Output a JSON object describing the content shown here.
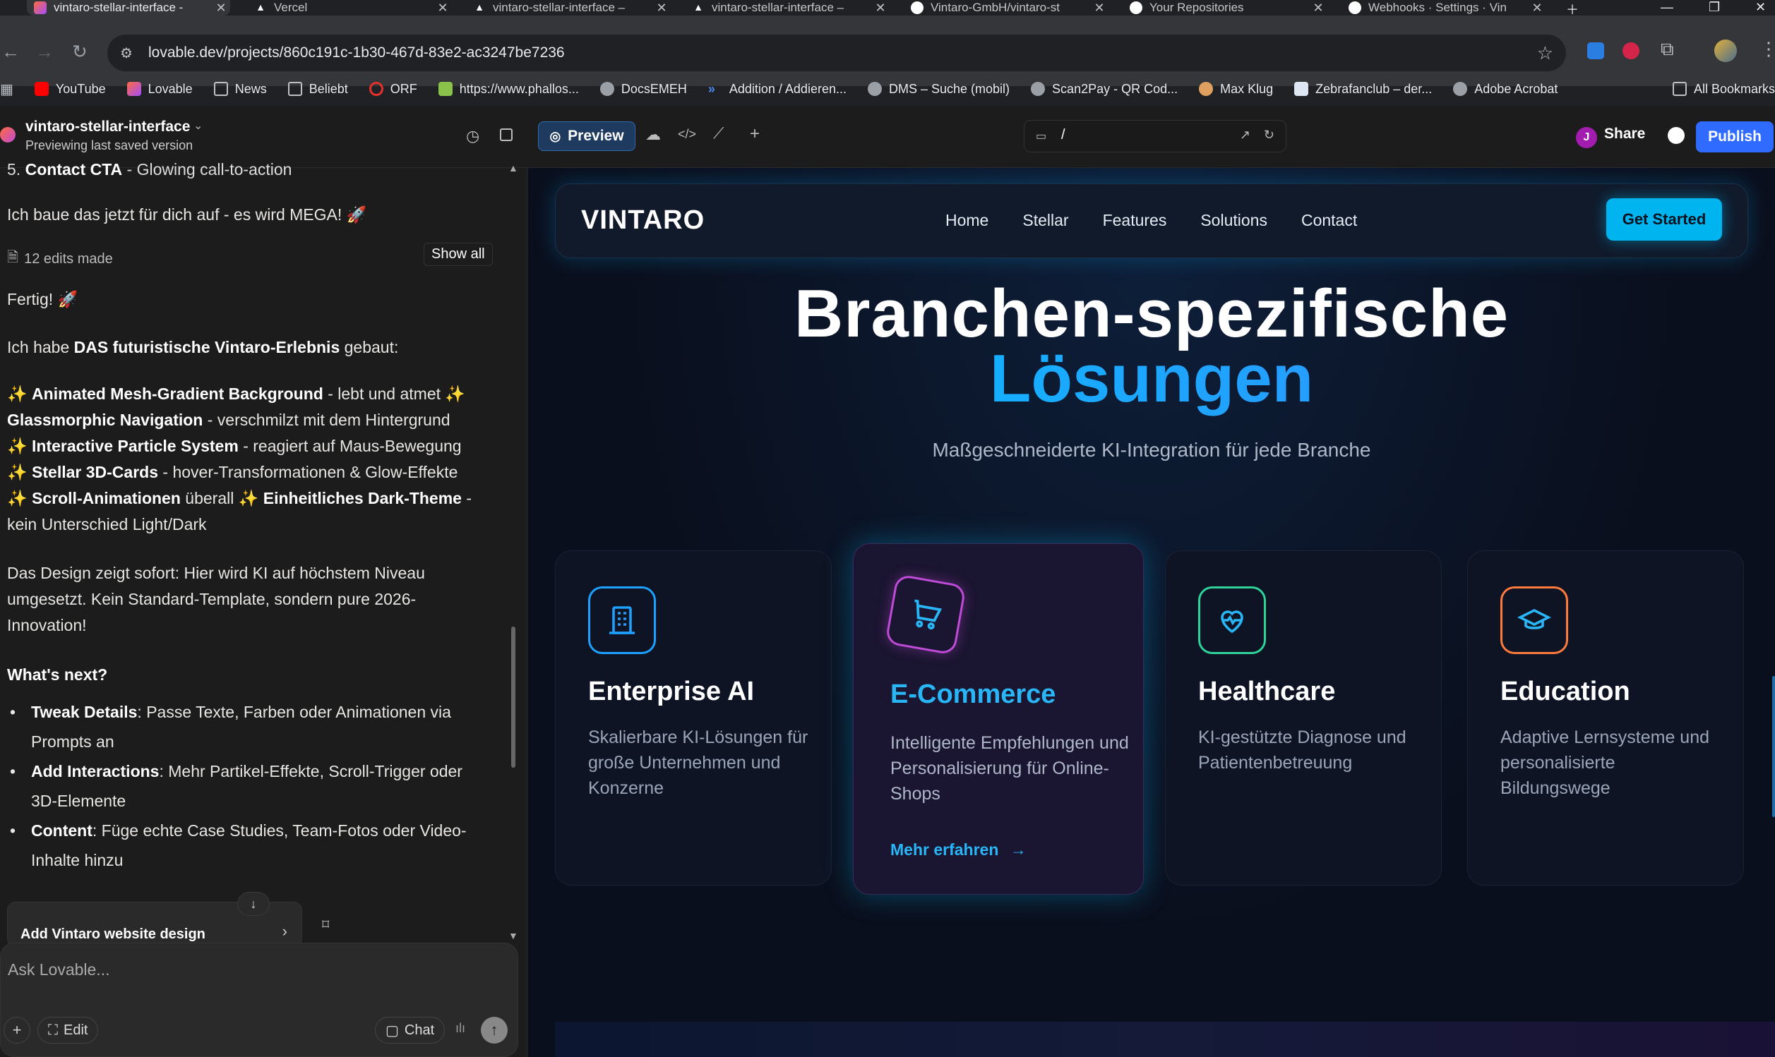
{
  "browser": {
    "tabs": [
      {
        "title": "vintaro-stellar-interface -",
        "active": true
      },
      {
        "title": "Vercel"
      },
      {
        "title": "vintaro-stellar-interface –"
      },
      {
        "title": "vintaro-stellar-interface –"
      },
      {
        "title": "Vintaro-GmbH/vintaro-st"
      },
      {
        "title": "Your Repositories"
      },
      {
        "title": "Webhooks · Settings · Vin"
      }
    ],
    "url": "lovable.dev/projects/860c191c-1b30-467d-83e2-ac3247be7236",
    "bookmarks": [
      "YouTube",
      "Lovable",
      "News",
      "Beliebt",
      "ORF",
      "https://www.phallos...",
      "DocsEMEH",
      "Addition / Addieren...",
      "DMS – Suche (mobil)",
      "Scan2Pay - QR Cod...",
      "Max Klug",
      "Zebrafanclub – der...",
      "Adobe Acrobat"
    ],
    "all_bookmarks": "All Bookmarks"
  },
  "app": {
    "project_name": "vintaro-stellar-interface",
    "project_status": "Previewing last saved version",
    "preview_label": "Preview",
    "route": "/",
    "avatar_letter": "J",
    "share_label": "Share",
    "publish_label": "Publish"
  },
  "chat": {
    "top_item": {
      "num": "5.",
      "bold": "Contact CTA",
      "rest": " - Glowing call-to-action"
    },
    "line_build": "Ich baue das jetzt für dich auf - es wird MEGA! 🚀",
    "edits": "12 edits made",
    "show_all": "Show all",
    "done": "Fertig! 🚀",
    "intro": {
      "pre": "Ich habe ",
      "bold": "DAS futuristische Vintaro-Erlebnis",
      "post": " gebaut:"
    },
    "features": {
      "f1b": "Animated Mesh-Gradient Background",
      "f1r": " - lebt und atmet ✨",
      "f2b": "Glassmorphic Navigation",
      "f2r": " - verschmilzt mit dem Hintergrund",
      "f3b": "Interactive Particle System",
      "f3r": " - reagiert auf Maus-Bewegung",
      "f4b": "Stellar 3D-Cards",
      "f4r": " - hover-Transformationen & Glow-Effekte",
      "f5b": "Scroll-Animationen",
      "f5r": " überall ✨ ",
      "f6b": "Einheitliches Dark-Theme",
      "f6r": " -",
      "f6c": "kein Unterschied Light/Dark"
    },
    "design_text": "Das Design zeigt sofort: Hier wird KI auf höchstem Niveau umgesetzt. Kein Standard-Template, sondern pure 2026-Innovation!",
    "whats_next": "What's next?",
    "next": [
      {
        "bold": "Tweak Details",
        "rest": ": Passe Texte, Farben oder Animationen via Prompts an"
      },
      {
        "bold": "Add Interactions",
        "rest": ": Mehr Partikel-Effekte, Scroll-Trigger oder 3D-Elemente"
      },
      {
        "bold": "Content",
        "rest": ": Füge echte Case Studies, Team-Fotos oder Video-Inhalte hinzu"
      }
    ],
    "suggestion": "Add Vintaro website design",
    "input_placeholder": "Ask Lovable...",
    "edit_label": "Edit",
    "chat_label": "Chat"
  },
  "site": {
    "logo": "VINTARO",
    "nav": [
      "Home",
      "Stellar",
      "Features",
      "Solutions",
      "Contact"
    ],
    "cta": "Get Started",
    "hero_line1": "Branchen-spezifische",
    "hero_line2": "Lösungen",
    "subtitle": "Maßgeschneiderte KI-Integration für jede Branche",
    "cards": [
      {
        "icon": "building-icon",
        "title": "Enterprise AI",
        "text": "Skalierbare KI-Lösungen für große Unternehmen und Konzerne",
        "color": "#1ea0ff"
      },
      {
        "icon": "cart-icon",
        "title": "E-Commerce",
        "text": "Intelligente Empfehlungen und Personalisierung für Online-Shops",
        "link": "Mehr erfahren",
        "color": "#c04bd8"
      },
      {
        "icon": "heart-pulse-icon",
        "title": "Healthcare",
        "text": "KI-gestützte Diagnose und Patientenbetreuung",
        "color": "#2fd39a"
      },
      {
        "icon": "graduation-cap-icon",
        "title": "Education",
        "text": "Adaptive Lernsysteme und personalisierte Bildungswege",
        "color": "#ff7a3d"
      }
    ],
    "colors": {
      "accent": "#00b4f0",
      "publish": "#2f6bff",
      "bg": "#0a0f1d"
    }
  }
}
